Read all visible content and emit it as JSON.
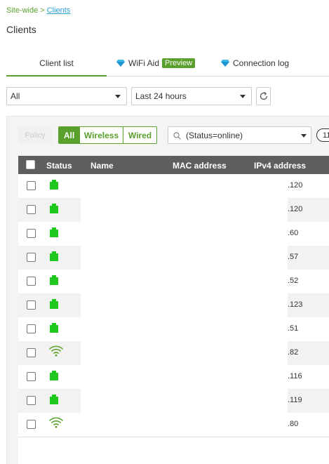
{
  "breadcrumb": {
    "root": "Site-wide",
    "separator": ">",
    "current": "Clients"
  },
  "page_title": "Clients",
  "tabs": [
    {
      "label": "Client list"
    },
    {
      "label": "WiFi Aid",
      "badge": "Preview"
    },
    {
      "label": "Connection log"
    }
  ],
  "filters": {
    "site": "All",
    "time_range": "Last 24 hours"
  },
  "toolbar": {
    "policy_label": "Policy",
    "segments": [
      "All",
      "Wireless",
      "Wired"
    ],
    "search_value": "(Status=online)",
    "count": "11"
  },
  "table": {
    "columns": [
      "Status",
      "Name",
      "MAC address",
      "IPv4 address"
    ],
    "rows": [
      {
        "status": "wired",
        "ip": ".120"
      },
      {
        "status": "wired",
        "ip": ".120"
      },
      {
        "status": "wired",
        "ip": ".60"
      },
      {
        "status": "wired",
        "ip": ".57"
      },
      {
        "status": "wired",
        "ip": ".52"
      },
      {
        "status": "wired",
        "ip": ".123"
      },
      {
        "status": "wired",
        "ip": ".51"
      },
      {
        "status": "wireless",
        "ip": ".82"
      },
      {
        "status": "wired",
        "ip": ".116"
      },
      {
        "status": "wired",
        "ip": ".119"
      },
      {
        "status": "wireless",
        "ip": ".80"
      }
    ]
  },
  "colors": {
    "accent_green": "#5aa02c",
    "status_green": "#1fc81f",
    "link_blue": "#2a9fd6",
    "header_gray": "#5e5e5e"
  }
}
